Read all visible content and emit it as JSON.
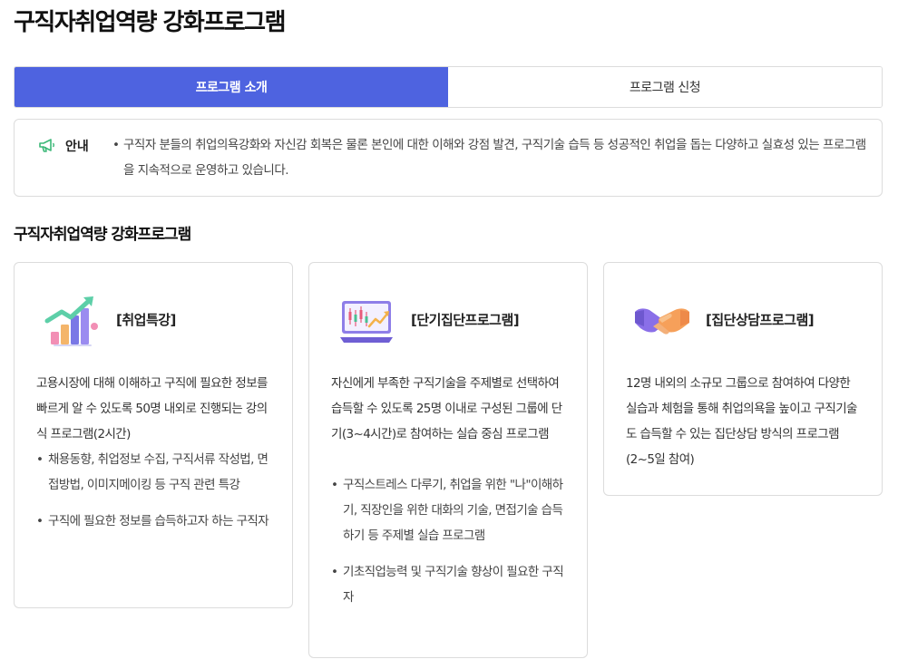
{
  "page": {
    "title": "구직자취업역량 강화프로그램"
  },
  "tabs": [
    {
      "label": "프로그램 소개",
      "active": true
    },
    {
      "label": "프로그램 신청",
      "active": false
    }
  ],
  "notice": {
    "icon": "megaphone-icon",
    "label": "안내",
    "text": "구직자 분들의 취업의욕강화와 자신감 회복은 물론 본인에 대한 이해와 강점 발견, 구직기술 습득 등 성공적인 취업을 돕는 다양하고 실효성 있는 프로그램을 지속적으로 운영하고 있습니다."
  },
  "section": {
    "title": "구직자취업역량 강화프로그램"
  },
  "cards": [
    {
      "icon": "growth-chart-icon",
      "title": "[취업특강]",
      "description": "고용시장에 대해 이해하고 구직에 필요한 정보를 빠르게 알 수 있도록 50명 내외로 진행되는 강의식 프로그램(2시간)",
      "bullets": [
        "채용동향, 취업정보 수집, 구직서류 작성법, 면접방법, 이미지메이킹 등 구직 관련 특강",
        "구직에 필요한 정보를 습득하고자 하는 구직자"
      ]
    },
    {
      "icon": "stock-monitor-icon",
      "title": "[단기집단프로그램]",
      "description": "자신에게 부족한 구직기술을 주제별로 선택하여 습득할 수 있도록 25명 이내로 구성된 그룹에 단기(3~4시간)로 참여하는 실습 중심 프로그램",
      "bullets": [
        "구직스트레스 다루기, 취업을 위한 \"나\"이해하기, 직장인을 위한 대화의 기술, 면접기술 습득하기 등 주제별 실습 프로그램",
        "기초직업능력 및 구직기술 향상이 필요한 구직자"
      ]
    },
    {
      "icon": "handshake-icon",
      "title": "[집단상담프로그램]",
      "description": "12명 내외의 소규모 그룹으로 참여하여 다양한 실습과 체험을 통해 취업의욕을 높이고 구직기술도 습득할 수 있는 집단상담 방식의 프로그램 (2~5일 참여)",
      "bullets": []
    }
  ]
}
